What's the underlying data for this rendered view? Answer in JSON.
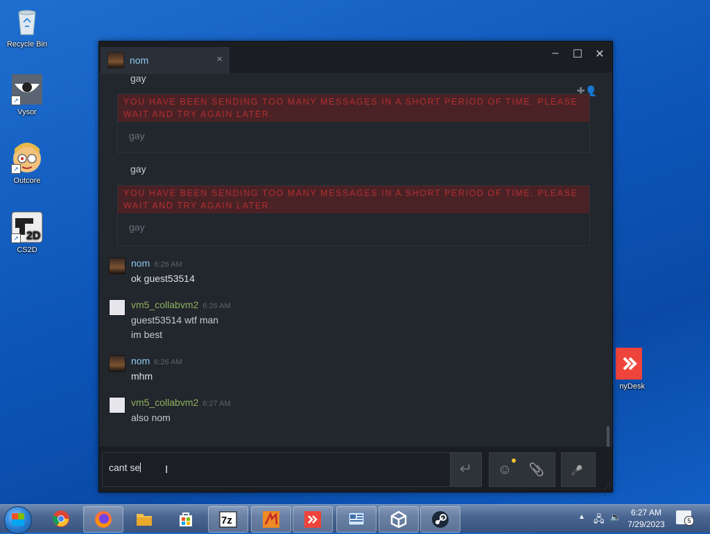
{
  "desktop": {
    "icons": [
      {
        "label": "Recycle Bin"
      },
      {
        "label": "Vysor"
      },
      {
        "label": "Outcore"
      },
      {
        "label": "CS2D"
      },
      {
        "label": "nyDesk"
      }
    ]
  },
  "chat": {
    "tab_name": "nom",
    "tab_close": "×",
    "window_controls": {
      "minimize": "–",
      "maximize": "☐",
      "close": "✕"
    },
    "messages_top_partial": "gay",
    "rate_limit_text": "YOU HAVE BEEN SENDING TOO MANY MESSAGES IN A SHORT PERIOD OF TIME. PLEASE WAIT AND TRY AGAIN LATER.",
    "failed_1": "gay",
    "plain_gay": "gay",
    "failed_2": "gay",
    "messages": [
      {
        "author": "nom",
        "time": "6:26 AM",
        "lines": [
          "ok guest53514"
        ],
        "color": "#8ec8f0"
      },
      {
        "author": "vm5_collabvm2",
        "time": "6:26 AM",
        "lines": [
          "guest53514 wtf man",
          "im best"
        ],
        "color": "#8fb35e"
      },
      {
        "author": "nom",
        "time": "6:26 AM",
        "lines": [
          "mhm"
        ],
        "color": "#8ec8f0"
      },
      {
        "author": "vm5_collabvm2",
        "time": "6:27 AM",
        "lines": [
          "also nom"
        ],
        "color": "#8fb35e"
      }
    ],
    "input_value": "cant se",
    "send_icon": "↵",
    "emoji_icon": "☺",
    "attach_icon": "📎",
    "mic_icon": "🎤"
  },
  "taskbar": {
    "clock_time": "6:27 AM",
    "clock_date": "7/29/2023",
    "notification_count": "5",
    "apps": [
      "chrome",
      "firefox",
      "file-explorer",
      "store",
      "7zip",
      "app-orange",
      "anydesk",
      "control-panel",
      "unity",
      "steam"
    ]
  },
  "colors": {
    "accent_blue": "#8ec8f0",
    "friend_green": "#8fb35e",
    "rate_limit_red": "#b32e2e"
  }
}
